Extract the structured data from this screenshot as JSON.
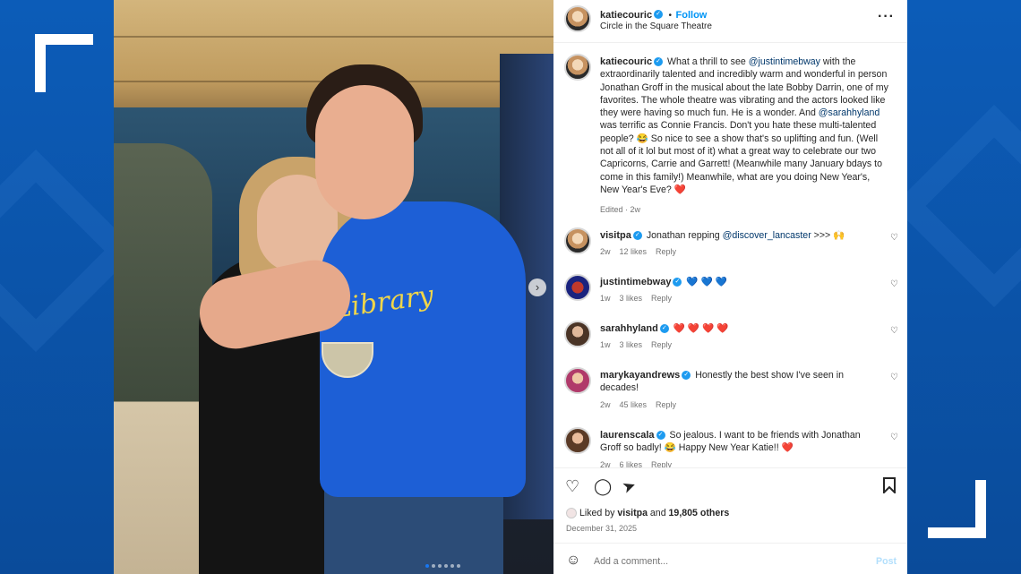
{
  "post": {
    "author": "katiecouric",
    "follow_label": "Follow",
    "dot": "•",
    "location": "Circle in the Square Theatre",
    "more_icon": "more-horizontal-icon",
    "caption": {
      "author": "katiecouric",
      "p1": " What a thrill to see ",
      "mention1": "@justintimebway",
      "p2": " with the extraordinarily talented and incredibly warm and wonderful in person Jonathan Groff in the musical about the late Bobby Darrin, one of my favorites. The whole theatre was vibrating and the actors looked like they were having so much fun. He is a wonder. And ",
      "mention2": "@sarahhyland",
      "p3": " was terrific as Connie Francis. Don't you hate these multi-talented people? 😂 So nice to see a show that's so uplifting and fun. (Well not all of it lol but most of it) what a great way to celebrate our two Capricorns, Carrie and Garrett! (Meanwhile many January bdays to come in this family!) Meanwhile, what are you doing New Year's, New Year's Eve? ❤️",
      "edited": "Edited · 2w"
    },
    "comments": [
      {
        "user": "visitpa",
        "text_pre": "Jonathan repping ",
        "mention": "@discover_lancaster",
        "text_post": " >>> 🙌",
        "age": "2w",
        "likes": "12 likes",
        "reply": "Reply"
      },
      {
        "user": "justintimebway",
        "text_pre": "💙 💙 💙",
        "mention": "",
        "text_post": "",
        "age": "1w",
        "likes": "3 likes",
        "reply": "Reply"
      },
      {
        "user": "sarahhyland",
        "text_pre": "❤️ ❤️ ❤️ ❤️",
        "mention": "",
        "text_post": "",
        "age": "1w",
        "likes": "3 likes",
        "reply": "Reply"
      },
      {
        "user": "marykayandrews",
        "text_pre": "Honestly the best show I've seen in decades!",
        "mention": "",
        "text_post": "",
        "age": "2w",
        "likes": "45 likes",
        "reply": "Reply"
      },
      {
        "user": "laurenscala",
        "text_pre": "So jealous. I want to be friends with Jonathan Groff so badly! 😂 Happy New Year Katie!! ❤️",
        "mention": "",
        "text_post": "",
        "age": "2w",
        "likes": "6 likes",
        "reply": "Reply"
      }
    ],
    "liked_by_prefix": "Liked by ",
    "liked_by_user": "visitpa",
    "liked_by_suffix": " and ",
    "liked_others": "19,805 others",
    "date": "December 31, 2025",
    "add_comment_placeholder": "Add a comment...",
    "post_label": "Post"
  },
  "photo": {
    "shirt_text": "Library"
  },
  "colors": {
    "link": "#00376b",
    "follow": "#0095f6",
    "brand_blue": "#0a4fa3"
  }
}
